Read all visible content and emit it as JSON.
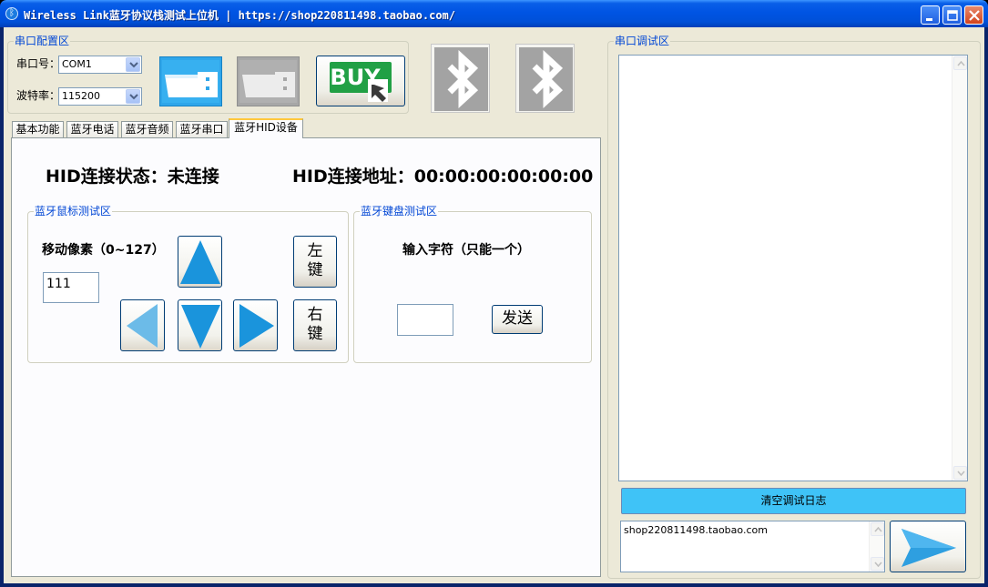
{
  "window": {
    "title": "Wireless Link蓝牙协议栈测试上位机 | https://shop220811498.taobao.com/"
  },
  "serial_config": {
    "group_title": "串口配置区",
    "port_label": "串口号：",
    "port_value": "COM1",
    "baud_label": "波特率：",
    "baud_value": "115200"
  },
  "buy_button": {
    "text": "BUY"
  },
  "tabs": [
    {
      "label": "基本功能"
    },
    {
      "label": "蓝牙电话"
    },
    {
      "label": "蓝牙音频"
    },
    {
      "label": "蓝牙串口"
    },
    {
      "label": "蓝牙HID设备",
      "active": true
    }
  ],
  "hid": {
    "status_label": "HID连接状态：未连接",
    "addr_label": "HID连接地址：00:00:00:00:00:00",
    "mouse_group_title": "蓝牙鼠标测试区",
    "move_pixels_label": "移动像素（0~127）",
    "move_pixels_value": "111",
    "left_key": "左\n键",
    "right_key": "右\n键",
    "keyboard_group_title": "蓝牙键盘测试区",
    "input_char_label": "输入字符（只能一个）",
    "input_char_value": "",
    "send_label": "发送"
  },
  "serial_debug": {
    "group_title": "串口调试区",
    "log_text": "",
    "clear_button": "清空调试日志",
    "input_text": "shop220811498.taobao.com"
  },
  "colors": {
    "accent_blue": "#2e9fe0",
    "clear_button_bg": "#3fc3f7",
    "buy_green": "#21a045",
    "group_title": "#0046d5"
  }
}
